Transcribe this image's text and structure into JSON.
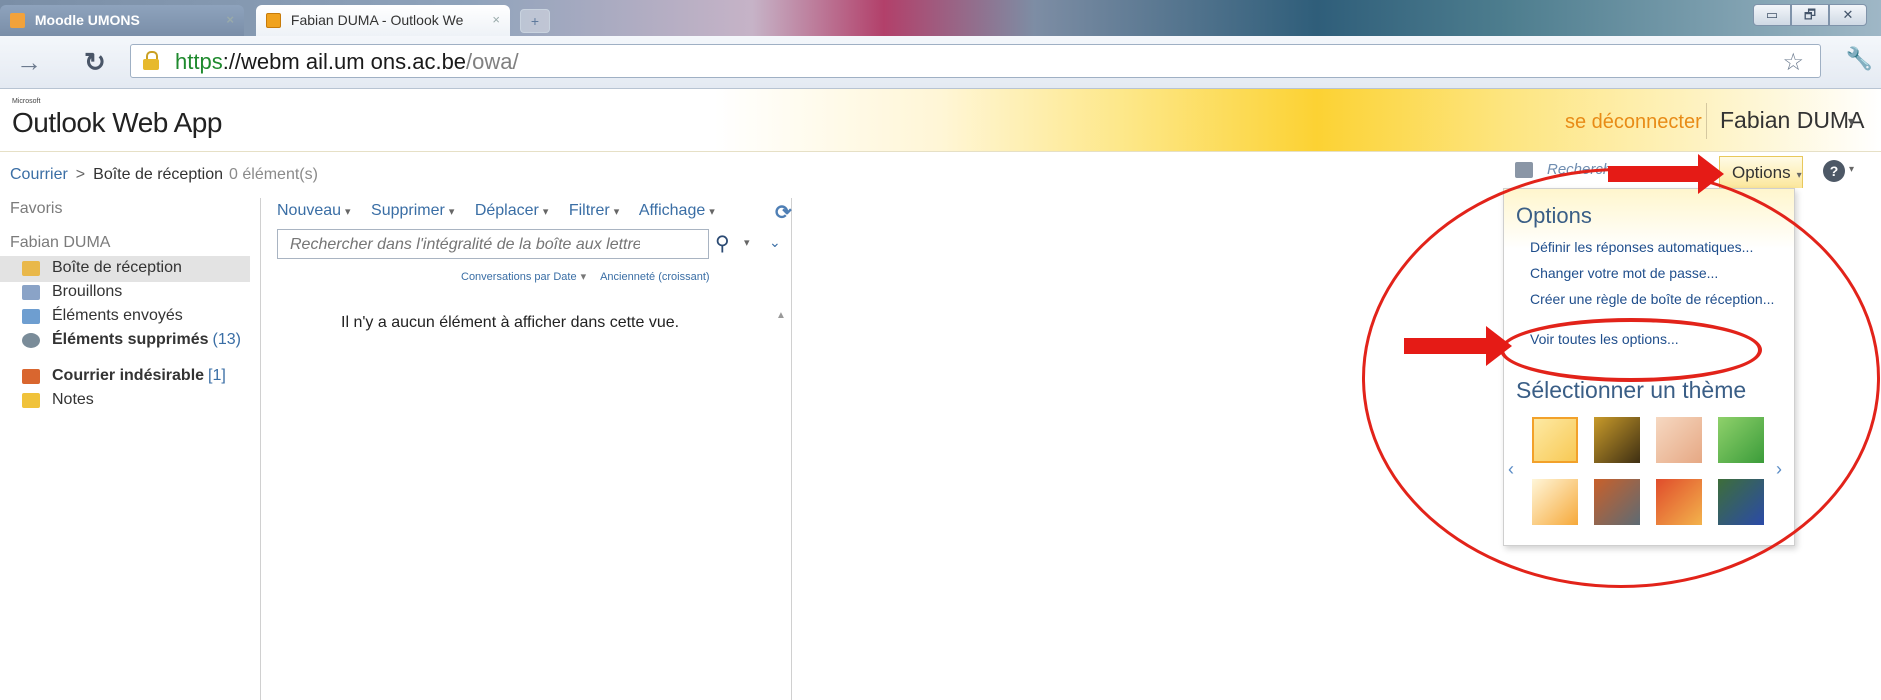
{
  "browser": {
    "tabs": [
      {
        "label": "Moodle UMONS",
        "close": "×"
      },
      {
        "label": "Fabian DUMA - Outlook We",
        "close": "×"
      }
    ],
    "new_tab": "+",
    "window_buttons": [
      "▭",
      "🗗",
      "✕"
    ],
    "url": {
      "scheme": "https",
      "host": "://webm ail.um ons.ac.be",
      "path": "/owa/"
    }
  },
  "header": {
    "brand_small": "Microsoft",
    "brand": "Outlook Web App",
    "logoff": "se déconnecter",
    "user": "Fabian DUMA"
  },
  "breadcrumb": {
    "root": "Courrier",
    "separator": ">",
    "current": "Boîte de réception",
    "count": "0 élément(s)"
  },
  "nav": {
    "favorites": "Favoris",
    "mailbox": "Fabian DUMA",
    "folders": [
      {
        "label": "Boîte de réception",
        "count": "",
        "bold": false,
        "selected": true,
        "icon": "inbox-icon",
        "color": "#e9b84a"
      },
      {
        "label": "Brouillons",
        "count": "",
        "bold": false,
        "selected": false,
        "icon": "drafts-icon",
        "color": "#8aa3c7"
      },
      {
        "label": "Éléments envoyés",
        "count": "",
        "bold": false,
        "selected": false,
        "icon": "sent-icon",
        "color": "#6e9ed0"
      },
      {
        "label": "Éléments supprimés",
        "count": "(13)",
        "bold": true,
        "selected": false,
        "icon": "deleted-icon",
        "color": "#7a8c99"
      },
      {
        "label": "Courrier indésirable",
        "count": "[1]",
        "bold": true,
        "selected": false,
        "icon": "junk-icon",
        "color": "#d9662f"
      },
      {
        "label": "Notes",
        "count": "",
        "bold": false,
        "selected": false,
        "icon": "notes-icon",
        "color": "#f0c23a"
      }
    ]
  },
  "list": {
    "commands": [
      "Nouveau",
      "Supprimer",
      "Déplacer",
      "Filtrer",
      "Affichage"
    ],
    "search_placeholder": "Rechercher dans l'intégralité de la boîte aux lettres",
    "sort_by": "Conversations par Date",
    "sort_order": "Ancienneté (croissant)",
    "empty_text": "Il n'y a aucun élément à afficher dans cette vue."
  },
  "options": {
    "find": "Recherch",
    "button": "Options",
    "help": "?",
    "title": "Options",
    "links": [
      "Définir les réponses automatiques...",
      "Changer votre mot de passe...",
      "Créer une règle de boîte de réception...",
      "Voir toutes les options..."
    ],
    "theme_title": "Sélectionner un thème",
    "themes": [
      {
        "name": "default",
        "colors": [
          "#fde9a3",
          "#f8c955"
        ],
        "selected": true
      },
      {
        "name": "bees",
        "colors": [
          "#c89a2a",
          "#3e2f13"
        ],
        "selected": false
      },
      {
        "name": "sketch",
        "colors": [
          "#f6d8c1",
          "#e6a884"
        ],
        "selected": false
      },
      {
        "name": "leaves",
        "colors": [
          "#8fd16b",
          "#3b9c3a"
        ],
        "selected": false
      },
      {
        "name": "sunrise",
        "colors": [
          "#fff6d9",
          "#f6a93a"
        ],
        "selected": false
      },
      {
        "name": "robots",
        "colors": [
          "#c9602a",
          "#5d6b74"
        ],
        "selected": false
      },
      {
        "name": "autumn",
        "colors": [
          "#e04c2b",
          "#f3b34c"
        ],
        "selected": false
      },
      {
        "name": "monsters",
        "colors": [
          "#3d6e39",
          "#2b4aa8"
        ],
        "selected": false
      }
    ]
  }
}
